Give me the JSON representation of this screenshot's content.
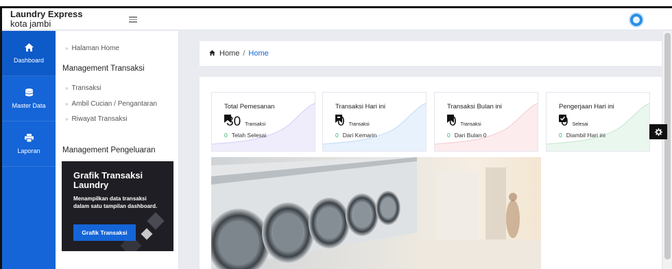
{
  "brand": {
    "line1": "Laundry Express",
    "line2": "kota jambi"
  },
  "rail": [
    {
      "label": "Dashboard",
      "icon": "home-icon",
      "glyph": "⌂"
    },
    {
      "label": "Master Data",
      "icon": "database-icon",
      "glyph": "≡"
    },
    {
      "label": "Laporan",
      "icon": "printer-icon",
      "glyph": "▤"
    }
  ],
  "submenu": {
    "home": "Halaman Home",
    "section1": "Management Transaksi",
    "items": [
      "Transaksi",
      "Ambil Cucian / Pengantaran",
      "Riwayat Transaksi"
    ],
    "section2": "Management Pengeluaran"
  },
  "promo": {
    "title": "Grafik Transaksi Laundry",
    "desc": "Menampilkan data transaksi dalam satu tampilan dashboard.",
    "button": "Grafik Transaksi"
  },
  "breadcrumb": {
    "home": "Home",
    "sep": "/",
    "current": "Home"
  },
  "stats": [
    {
      "title": "Total Pemesanan",
      "value": "30",
      "unit": "Transaksi",
      "delta": "0",
      "foot": "Telah Selesai",
      "icon": "bookmark-icon",
      "glyph": "▮",
      "tint": "#e9e7fb",
      "line": "#c9c3f3"
    },
    {
      "title": "Transaksi Hari ini",
      "value": "0",
      "unit": "Transaksi",
      "delta": "0",
      "foot": "Dari Kemarin",
      "icon": "bookmark-icon",
      "glyph": "▮",
      "tint": "#e3f0fd",
      "line": "#b8d8f7"
    },
    {
      "title": "Transaksi Bulan ini",
      "value": "0",
      "unit": "Transaksi",
      "delta": "0",
      "foot": "Dari Bulan 0",
      "icon": "bookmark-icon",
      "glyph": "▮",
      "tint": "#fde9ec",
      "line": "#f5c4cc"
    },
    {
      "title": "Pengerjaan Hari ini",
      "value": "0",
      "unit": "Selesai",
      "delta": "0",
      "foot": "Diambil Hari ini",
      "icon": "check-box-icon",
      "glyph": "☑",
      "tint": "#e6f6ea",
      "line": "#bfe6c8"
    }
  ],
  "colors": {
    "primary": "#1565d8",
    "success": "#2db36b",
    "promo_bg": "#1e1e24"
  }
}
